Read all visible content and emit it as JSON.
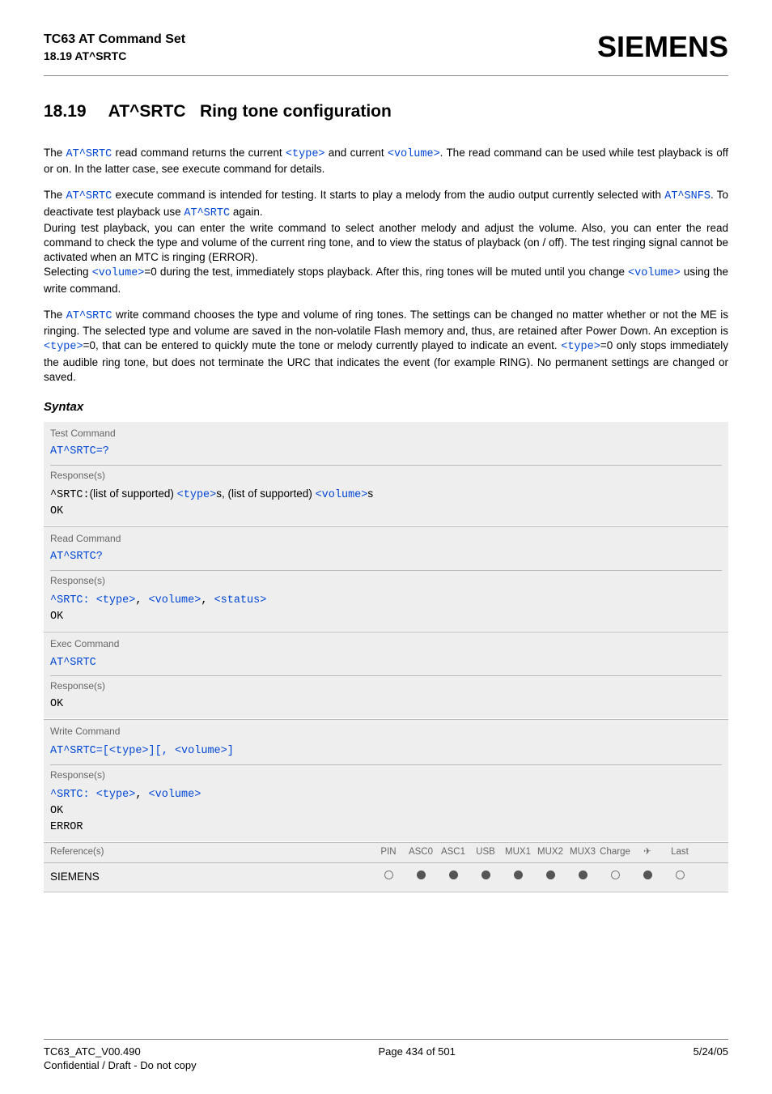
{
  "header": {
    "title": "TC63 AT Command Set",
    "subtitle": "18.19 AT^SRTC",
    "brand": "SIEMENS"
  },
  "section": {
    "number": "18.19",
    "cmd": "AT^SRTC",
    "name": "Ring tone configuration"
  },
  "body": {
    "p1_a": "The ",
    "p1_b": "AT^SRTC",
    "p1_c": " read command returns the current ",
    "p1_d": "<type>",
    "p1_e": " and current ",
    "p1_f": "<volume>",
    "p1_g": ". The read command can be used while test playback is off or on. In the latter case, see execute command for details.",
    "p2_a": "The ",
    "p2_b": "AT^SRTC",
    "p2_c": " execute command is intended for testing. It starts to play a melody from the audio output currently selected with ",
    "p2_d": "AT^SNFS",
    "p2_e": ". To deactivate test playback use ",
    "p2_f": "AT^SRTC",
    "p2_g": " again.",
    "p2_h": "During test playback, you can enter the write command to select another melody and adjust the volume. Also, you can enter the read command to check the type and volume of the current ring tone, and to view the status of playback (on / off). The test ringing signal cannot be activated when an MTC is ringing (ERROR).",
    "p2_i": "Selecting ",
    "p2_j": "<volume>",
    "p2_k": "=0 during the test, immediately stops playback. After this, ring tones will be muted until you change ",
    "p2_l": "<volume>",
    "p2_m": " using the write command.",
    "p3_a": "The ",
    "p3_b": "AT^SRTC",
    "p3_c": " write command chooses the type and volume of ring tones. The settings can be changed no matter whether or not the ME is ringing. The selected type and volume are saved in the non-volatile Flash memory and, thus, are retained after Power Down. An exception is ",
    "p3_d": "<type>",
    "p3_e": "=0, that can be entered to quickly mute the tone or melody currently played to indicate an event. ",
    "p3_f": "<type>",
    "p3_g": "=0 only stops immediately the audible ring tone, but does not terminate the URC that indicates the event (for example RING). No permanent settings are changed or saved."
  },
  "syntax_label": "Syntax",
  "syntax": {
    "test": {
      "label": "Test Command",
      "cmd": "AT^SRTC=?",
      "resp_label": "Response(s)",
      "resp_a": "^SRTC:",
      "resp_b": "(list of supported) ",
      "resp_c": "<type>",
      "resp_d": "s, (list of supported) ",
      "resp_e": "<volume>",
      "resp_f": "s",
      "ok": "OK"
    },
    "read": {
      "label": "Read Command",
      "cmd": "AT^SRTC?",
      "resp_label": "Response(s)",
      "resp_a": "^SRTC: ",
      "resp_b": "<type>",
      "resp_c": ", ",
      "resp_d": "<volume>",
      "resp_e": ", ",
      "resp_f": "<status>",
      "ok": "OK"
    },
    "exec": {
      "label": "Exec Command",
      "cmd": "AT^SRTC",
      "resp_label": "Response(s)",
      "ok": "OK"
    },
    "write": {
      "label": "Write Command",
      "cmd_a": "AT^SRTC=[",
      "cmd_b": "<type>",
      "cmd_c": "][, ",
      "cmd_d": "<volume>",
      "cmd_e": "]",
      "resp_label": "Response(s)",
      "resp_a": "^SRTC: ",
      "resp_b": "<type>",
      "resp_c": ", ",
      "resp_d": "<volume>",
      "ok": "OK",
      "error": "ERROR"
    },
    "ref": {
      "label": "Reference(s)",
      "cols": [
        "PIN",
        "ASC0",
        "ASC1",
        "USB",
        "MUX1",
        "MUX2",
        "MUX3",
        "Charge",
        "✈",
        "Last"
      ],
      "vendor": "SIEMENS",
      "values": [
        "empty",
        "fill",
        "fill",
        "fill",
        "fill",
        "fill",
        "fill",
        "empty",
        "fill",
        "empty"
      ]
    }
  },
  "footer": {
    "left": "TC63_ATC_V00.490",
    "center": "Page 434 of 501",
    "right": "5/24/05",
    "sub": "Confidential / Draft - Do not copy"
  }
}
